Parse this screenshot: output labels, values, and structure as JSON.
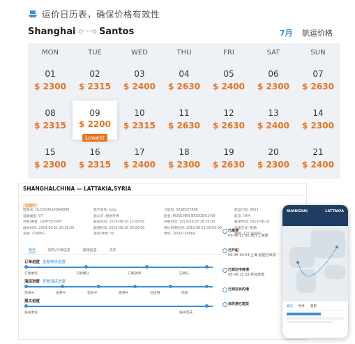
{
  "header": {
    "title": "运价日历表，确保价格有效性",
    "origin": "Shanghai",
    "route_dots": "o·······o",
    "destination": "Santos",
    "month": "7月",
    "route_price": "航运价格"
  },
  "calendar": {
    "weekdays": [
      "MON",
      "TUE",
      "WED",
      "THU",
      "FRI",
      "SAT",
      "SUN"
    ],
    "weeks": [
      [
        {
          "day": "01",
          "price": "$ 2300"
        },
        {
          "day": "02",
          "price": "$ 2315"
        },
        {
          "day": "03",
          "price": "$ 2400"
        },
        {
          "day": "04",
          "price": "$ 2630"
        },
        {
          "day": "05",
          "price": "$ 2400"
        },
        {
          "day": "06",
          "price": "$ 2300"
        },
        {
          "day": "07",
          "price": "$ 2630"
        }
      ],
      [
        {
          "day": "08",
          "price": "$ 2315"
        },
        {
          "day": "09",
          "price": "$ 2200",
          "badge": "Lowest"
        },
        {
          "day": "10",
          "price": "$ 2315"
        },
        {
          "day": "11",
          "price": "$ 2630"
        },
        {
          "day": "12",
          "price": "$ 2630"
        },
        {
          "day": "13",
          "price": "$ 2400"
        },
        {
          "day": "14",
          "price": "$ 2300"
        }
      ],
      [
        {
          "day": "15",
          "price": "$ 2300"
        },
        {
          "day": "16",
          "price": "$ 2315"
        },
        {
          "day": "17",
          "price": "$ 2400"
        },
        {
          "day": "18",
          "price": "$ 2300"
        },
        {
          "day": "19",
          "price": "$ 2630"
        },
        {
          "day": "20",
          "price": "$ 2300"
        },
        {
          "day": "21",
          "price": "$ 2400"
        }
      ]
    ]
  },
  "detail": {
    "route_title": "SHANGHAI,CHINA — LATTAKIA,SYRIA",
    "status_tag": "运输中",
    "info_rows": [
      [
        "提单号: HLCUSHA1906AEM0",
        "客户单号: long",
        "订舱号: SASE5Z7896",
        "航运代码: 0053"
      ],
      [
        "运输类型: CY",
        "船公司: 赫伯罗特",
        "船名: MUNCHEN BRIDGE/024W",
        "航次: 04M"
      ],
      [
        "件数/重量: 160PT/500KT",
        "截关时间: 2019-06-20 15:00:00",
        "开船时间: 2019-06-23 18:00:00",
        "截单时间: 2019-06-18"
      ],
      [
        "截关时间: 2019-06-21 00:00:00",
        "截港时间: 2019-06-20 00:00:00",
        "预计到港时间: 2019-08-23 00:00:00",
        "运输方式: 整箱"
      ],
      [
        "毛重: 3748KG",
        "包装/件数: 50",
        "体积: 28000.000KG",
        "金额: 125.600M³"
      ]
    ],
    "tabs": [
      "概览",
      "附件/订单信息",
      "费用信息",
      "文件"
    ],
    "track_sections": [
      {
        "title": "订单进度",
        "link": "查看物流进度",
        "steps": [
          "订舱委托",
          "订舱确认",
          "订舱放单",
          "已确认"
        ]
      },
      {
        "title": "海运进度",
        "link": "查看海运进度",
        "steps": [
          "提单中",
          "进港中",
          "装船中",
          "离港中",
          "已进港",
          "完结"
        ]
      },
      {
        "title": "报关进度",
        "link": "",
        "steps": [
          "报关委托",
          "报关完成"
        ]
      }
    ],
    "right_events": [
      {
        "title": "已离港",
        "desc": "09-06 11:56 离开上海港"
      },
      {
        "title": "已开船",
        "desc": "09-06 19:54 上海 船舶已出发"
      },
      {
        "title": "已到达中转港",
        "desc": "09-08 21:28 新加坡港"
      },
      {
        "title": "已到达目的港",
        "desc": ""
      },
      {
        "title": "目的港已提货",
        "desc": ""
      }
    ]
  },
  "phone": {
    "origin": "SHANGHAI",
    "destination": "LATTAKIA",
    "tabs": [
      "概览",
      "附件",
      "费用"
    ]
  }
}
